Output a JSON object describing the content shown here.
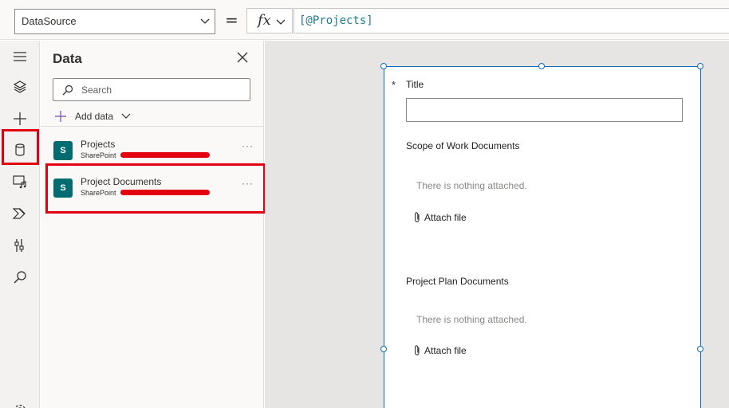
{
  "formula_bar": {
    "property": "DataSource",
    "equals": "=",
    "fx_label": "fx",
    "formula": "[@Projects]"
  },
  "rail": {
    "items": [
      {
        "icon": "hamburger-icon"
      },
      {
        "icon": "layers-icon"
      },
      {
        "icon": "plus-icon"
      },
      {
        "icon": "database-icon",
        "active": true
      },
      {
        "icon": "media-icon"
      },
      {
        "icon": "power-automate-icon"
      },
      {
        "icon": "advanced-tools-icon"
      },
      {
        "icon": "search-icon"
      },
      {
        "icon": "settings-icon"
      }
    ],
    "highlight_color": "#e3000f"
  },
  "panel": {
    "title": "Data",
    "search_placeholder": "Search",
    "add_data_label": "Add data",
    "sources": [
      {
        "name": "Projects",
        "type": "SharePoint",
        "icon": "sharepoint-icon",
        "icon_letter": "S"
      },
      {
        "name": "Project Documents",
        "type": "SharePoint",
        "icon": "sharepoint-icon",
        "icon_letter": "S"
      }
    ],
    "more_label": "···"
  },
  "form": {
    "required_marker": "*",
    "title_label": "Title",
    "scope_label": "Scope of Work Documents",
    "scope_empty": "There is nothing attached.",
    "scope_attach": "Attach file",
    "plan_label": "Project Plan Documents",
    "plan_empty": "There is nothing attached.",
    "plan_attach": "Attach file"
  },
  "colors": {
    "sharepoint": "#036c70",
    "selection": "#0f6cbd",
    "annotation_red": "#e3000f"
  }
}
